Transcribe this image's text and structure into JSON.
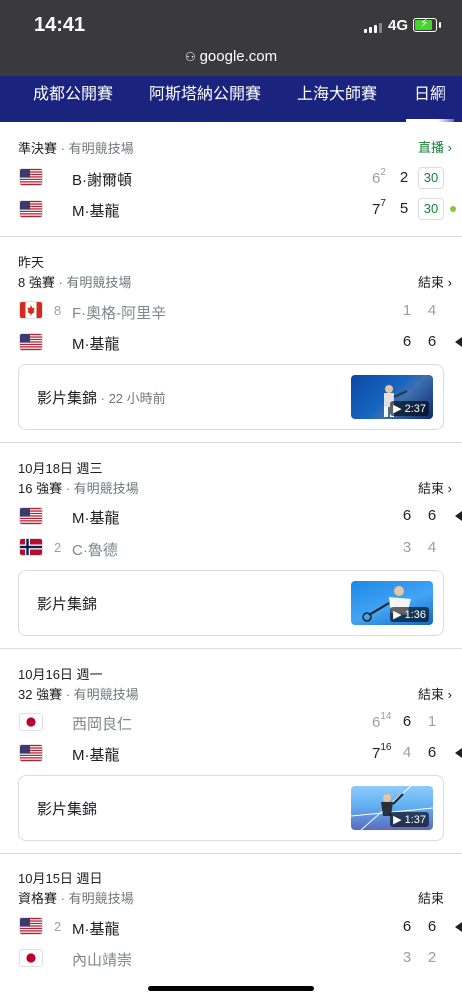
{
  "status_bar": {
    "time": "14:41",
    "network": "4G"
  },
  "url_bar": {
    "domain": "google.com"
  },
  "tabs": [
    {
      "label": "成都公開賽"
    },
    {
      "label": "阿斯塔納公開賽"
    },
    {
      "label": "上海大師賽"
    },
    {
      "label": "日網"
    }
  ],
  "matches": [
    {
      "round": "準決賽",
      "venue": " · 有明競技場",
      "status": "直播 ›",
      "players": [
        {
          "name": "B·謝爾頓",
          "country": "USA",
          "sets": [
            "6",
            "2"
          ],
          "set1_tb": "2",
          "game_score": "30"
        },
        {
          "name": "M·基龍",
          "country": "USA",
          "sets": [
            "7",
            "5"
          ],
          "set1_tb": "7",
          "game_score": "30"
        }
      ]
    },
    {
      "date": "昨天",
      "round": "8 強賽",
      "venue": " · 有明競技場",
      "status": "結束 ›",
      "players": [
        {
          "seed": "8",
          "name": "F·奧格-阿里辛",
          "country": "CAN",
          "sets": [
            "1",
            "4"
          ]
        },
        {
          "name": "M·基龍",
          "country": "USA",
          "sets": [
            "6",
            "6"
          ]
        }
      ],
      "highlight": {
        "label": "影片集錦",
        "meta": " · 22 小時前",
        "duration": "2:37"
      }
    },
    {
      "date": "10月18日 週三",
      "round": "16 強賽",
      "venue": " · 有明競技場",
      "status": "結束 ›",
      "players": [
        {
          "name": "M·基龍",
          "country": "USA",
          "sets": [
            "6",
            "6"
          ]
        },
        {
          "seed": "2",
          "name": "C·魯德",
          "country": "NOR",
          "sets": [
            "3",
            "4"
          ]
        }
      ],
      "highlight": {
        "label": "影片集錦",
        "duration": "1:36"
      }
    },
    {
      "date": "10月16日 週一",
      "round": "32 強賽",
      "venue": " · 有明競技場",
      "status": "結束 ›",
      "players": [
        {
          "name": "西岡良仁",
          "country": "JPN",
          "sets": [
            "6",
            "6",
            "1"
          ],
          "set1_tb": "14"
        },
        {
          "name": "M·基龍",
          "country": "USA",
          "sets": [
            "7",
            "4",
            "6"
          ],
          "set1_tb": "16"
        }
      ],
      "highlight": {
        "label": "影片集錦",
        "duration": "1:37"
      }
    },
    {
      "date": "10月15日 週日",
      "round": "資格賽",
      "venue": " · 有明競技場",
      "status": "結束",
      "players": [
        {
          "seed": "2",
          "name": "M·基龍",
          "country": "USA",
          "sets": [
            "6",
            "6"
          ]
        },
        {
          "name": "內山靖崇",
          "country": "JPN",
          "sets": [
            "3",
            "2"
          ]
        }
      ]
    }
  ],
  "colors": {
    "tab_bar": "#1a237e",
    "live_green": "#188038",
    "status_bar": "#3a3a3c"
  }
}
